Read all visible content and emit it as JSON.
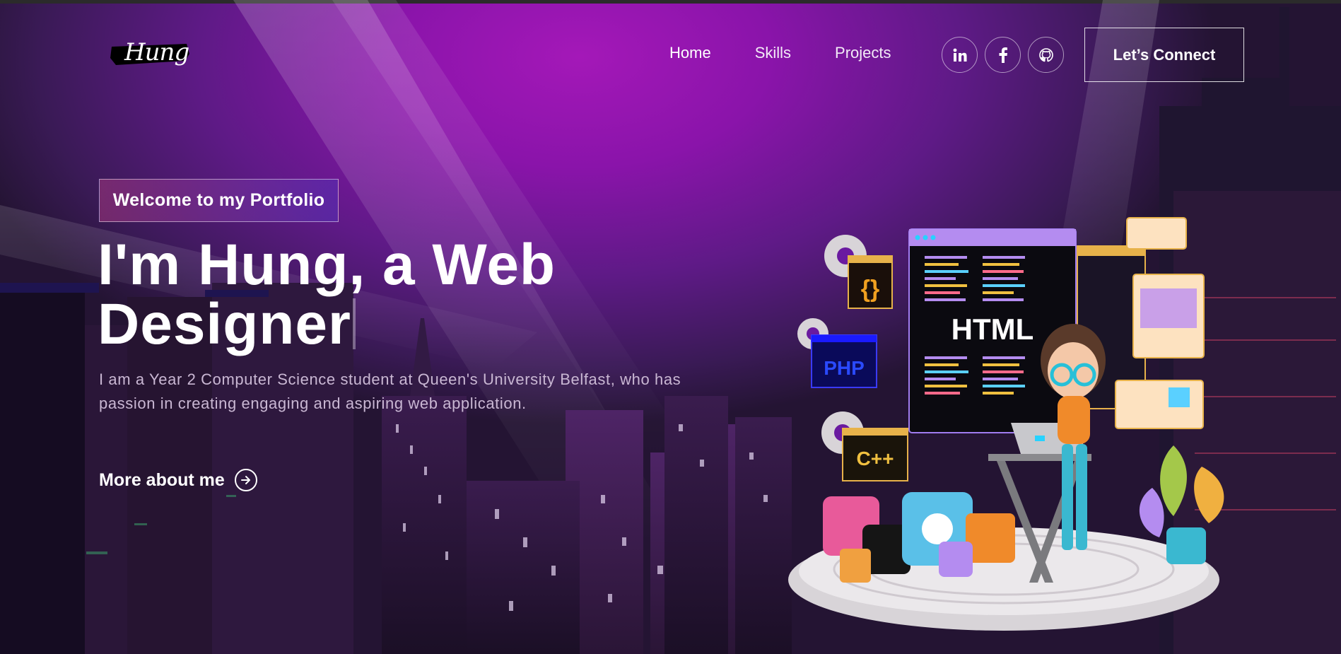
{
  "nav": {
    "logo_text": "Hung",
    "links": [
      {
        "label": "Home"
      },
      {
        "label": "Skills"
      },
      {
        "label": "Projects"
      }
    ],
    "socials": [
      {
        "icon": "linkedin-icon",
        "glyph": "in"
      },
      {
        "icon": "facebook-icon",
        "glyph": "f"
      },
      {
        "icon": "github-icon",
        "glyph": "gh"
      }
    ],
    "connect_label": "Let’s Connect"
  },
  "hero": {
    "tagline": "Welcome to my Portfolio",
    "headline_line1": "I'm Hung, a Web",
    "headline_line2": "Designer",
    "description": "I am a Year 2 Computer Science student at Queen's University Belfast, who has passion in creating engaging and aspiring web application.",
    "cta_label": "More about me"
  },
  "illustration": {
    "labels": {
      "html": "HTML",
      "php": "PHP",
      "cpp": "C++",
      "curly": "{}"
    }
  },
  "colors": {
    "accent_gradient_start": "#AA367C",
    "accent_gradient_end": "#4A2FBD",
    "background_purple": "#8a14aa"
  }
}
